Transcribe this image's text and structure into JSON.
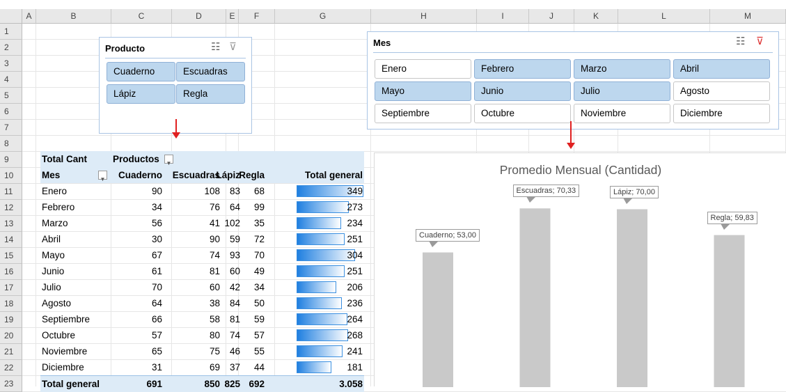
{
  "spreadsheet": {
    "columns": [
      "A",
      "B",
      "C",
      "D",
      "E",
      "F",
      "G",
      "H",
      "I",
      "J",
      "K",
      "L",
      "M"
    ],
    "rows": [
      "1",
      "2",
      "3",
      "4",
      "5",
      "6",
      "7",
      "8",
      "9",
      "10",
      "11",
      "12",
      "13",
      "14",
      "15",
      "16",
      "17",
      "18",
      "19",
      "20",
      "21",
      "22",
      "23"
    ]
  },
  "product_slicer": {
    "title": "Producto",
    "items": [
      {
        "label": "Cuaderno",
        "selected": true
      },
      {
        "label": "Escuadras",
        "selected": true
      },
      {
        "label": "Lápiz",
        "selected": true
      },
      {
        "label": "Regla",
        "selected": true
      }
    ]
  },
  "month_slicer": {
    "title": "Mes",
    "items": [
      {
        "label": "Enero",
        "selected": false
      },
      {
        "label": "Febrero",
        "selected": true
      },
      {
        "label": "Marzo",
        "selected": true
      },
      {
        "label": "Abril",
        "selected": true
      },
      {
        "label": "Mayo",
        "selected": true
      },
      {
        "label": "Junio",
        "selected": true
      },
      {
        "label": "Julio",
        "selected": true
      },
      {
        "label": "Agosto",
        "selected": false
      },
      {
        "label": "Septiembre",
        "selected": false
      },
      {
        "label": "Octubre",
        "selected": false
      },
      {
        "label": "Noviembre",
        "selected": false
      },
      {
        "label": "Diciembre",
        "selected": false
      }
    ]
  },
  "pivot": {
    "corner_label": "Total Cant",
    "columns_label": "Productos",
    "row_label": "Mes",
    "headers": [
      "Cuaderno",
      "Escuadras",
      "Lápiz",
      "Regla",
      "Total general"
    ],
    "rows": [
      {
        "mes": "Enero",
        "v": [
          "90",
          "108",
          "83",
          "68",
          "349"
        ],
        "total": 349
      },
      {
        "mes": "Febrero",
        "v": [
          "34",
          "76",
          "64",
          "99",
          "273"
        ],
        "total": 273
      },
      {
        "mes": "Marzo",
        "v": [
          "56",
          "41",
          "102",
          "35",
          "234"
        ],
        "total": 234
      },
      {
        "mes": "Abril",
        "v": [
          "30",
          "90",
          "59",
          "72",
          "251"
        ],
        "total": 251
      },
      {
        "mes": "Mayo",
        "v": [
          "67",
          "74",
          "93",
          "70",
          "304"
        ],
        "total": 304
      },
      {
        "mes": "Junio",
        "v": [
          "61",
          "81",
          "60",
          "49",
          "251"
        ],
        "total": 251
      },
      {
        "mes": "Julio",
        "v": [
          "70",
          "60",
          "42",
          "34",
          "206"
        ],
        "total": 206
      },
      {
        "mes": "Agosto",
        "v": [
          "64",
          "38",
          "84",
          "50",
          "236"
        ],
        "total": 236
      },
      {
        "mes": "Septiembre",
        "v": [
          "66",
          "58",
          "81",
          "59",
          "264"
        ],
        "total": 264
      },
      {
        "mes": "Octubre",
        "v": [
          "57",
          "80",
          "74",
          "57",
          "268"
        ],
        "total": 268
      },
      {
        "mes": "Noviembre",
        "v": [
          "65",
          "75",
          "46",
          "55",
          "241"
        ],
        "total": 241
      },
      {
        "mes": "Diciembre",
        "v": [
          "31",
          "69",
          "37",
          "44",
          "181"
        ],
        "total": 181
      }
    ],
    "total_label": "Total general",
    "totals": [
      "691",
      "850",
      "825",
      "692",
      "3.058"
    ]
  },
  "chart_data": {
    "type": "bar",
    "title": "Promedio Mensual (Cantidad)",
    "categories": [
      "Cuaderno",
      "Escuadras",
      "Lápiz",
      "Regla"
    ],
    "values": [
      53.0,
      70.33,
      70.0,
      59.83
    ],
    "data_labels": [
      "Cuaderno; 53,00",
      "Escuadras; 70,33",
      "Lápiz; 70,00",
      "Regla; 59,83"
    ],
    "bar_color": "#c9c9c9",
    "grid": false
  },
  "colors": {
    "selected_item": "#bdd7ee",
    "pivot_header": "#ddebf7",
    "databar": "#1f7fe0",
    "arrow": "#e02020"
  }
}
